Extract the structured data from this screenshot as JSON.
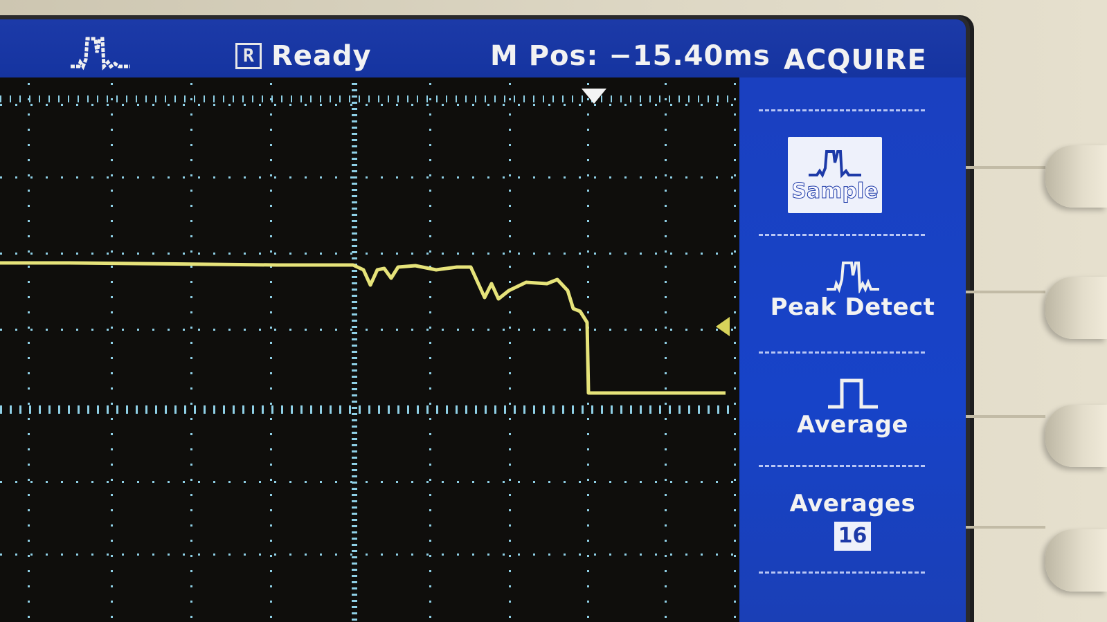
{
  "status_bar": {
    "acquire_mode_icon": "sample-pulse-icon",
    "run_badge": "R",
    "run_state": "Ready",
    "main_position": "M Pos: −15.40ms"
  },
  "menu": {
    "title": "ACQUIRE",
    "items": [
      {
        "label": "Sample",
        "icon": "sample-pulse-icon",
        "selected": true
      },
      {
        "label": "Peak Detect",
        "icon": "peak-detect-icon",
        "selected": false
      },
      {
        "label": "Average",
        "icon": "average-pulse-icon",
        "selected": false
      },
      {
        "label": "Averages",
        "value": "16"
      }
    ]
  },
  "colors": {
    "trace": "#e6e37a",
    "graticule": "#8fd0e6",
    "status_bar": "#1534a0",
    "menu_panel": "#1743c8"
  }
}
